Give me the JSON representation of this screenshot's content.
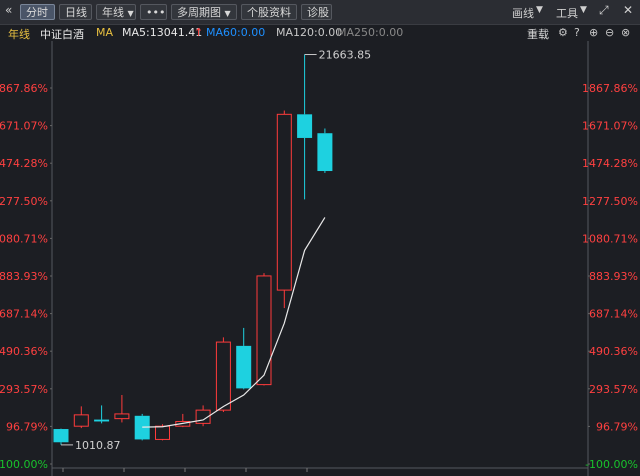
{
  "toolbar": {
    "back_icon": "chevron-double-left-icon",
    "timeshare": "分时",
    "daily": "日线",
    "period": "年线",
    "more": "•••",
    "multi_period": "多周期图",
    "stock_info": "个股资料",
    "diagnosis": "诊股",
    "draw_line": "画线",
    "tools": "工具",
    "fullscreen_icon": "expand-icon",
    "close_icon": "close-icon"
  },
  "infobar": {
    "period": "年线",
    "name": "中证白酒",
    "ma_label": "MA",
    "ma5": "MA5:13041.41",
    "ma5_arrow": "↑",
    "ma60": "MA60:0.00",
    "ma120": "MA120:0.00",
    "ma250": "MA250:0.00",
    "rights_adjust": "重载",
    "icons": [
      "gear-icon",
      "question-icon",
      "zoom-in-icon",
      "zoom-out-icon",
      "close-icon"
    ]
  },
  "colors": {
    "up": "#ff3b3b",
    "down": "#1ed1e0",
    "ma5": "#e8e8e8",
    "ma60": "#1e90ff",
    "ma120": "#c8c8c8",
    "ma250": "#888888",
    "axis_up": "#ff4040",
    "axis_down": "#19c32c"
  },
  "chart_data": {
    "type": "candlestick",
    "y_axis_labels": [
      "1867.86%",
      "1671.07%",
      "1474.28%",
      "1277.50%",
      "1080.71%",
      "883.93%",
      "687.14%",
      "490.36%",
      "293.57%",
      "96.79%",
      "-100.00%"
    ],
    "ylim_percent": [
      -100,
      1867.86
    ],
    "base_price": 1010.87,
    "max_label": "21663.85",
    "min_label": "1010.87",
    "candles": [
      {
        "open": 1850,
        "close": 1150,
        "high": 1870,
        "low": 1010.87
      },
      {
        "open": 2000,
        "close": 2600,
        "high": 3050,
        "low": 1900
      },
      {
        "open": 2350,
        "close": 2250,
        "high": 3100,
        "low": 2150
      },
      {
        "open": 2400,
        "close": 2650,
        "high": 3650,
        "low": 2200
      },
      {
        "open": 2550,
        "close": 1300,
        "high": 2650,
        "low": 1250
      },
      {
        "open": 1300,
        "close": 2000,
        "high": 2100,
        "low": 1250
      },
      {
        "open": 2000,
        "close": 2250,
        "high": 2650,
        "low": 1950
      },
      {
        "open": 2150,
        "close": 2850,
        "high": 3100,
        "low": 2000
      },
      {
        "open": 2850,
        "close": 6450,
        "high": 6700,
        "low": 2750
      },
      {
        "open": 6250,
        "close": 4000,
        "high": 7200,
        "low": 3950
      },
      {
        "open": 4200,
        "close": 9950,
        "high": 10100,
        "low": 4150
      },
      {
        "open": 9200,
        "close": 18500,
        "high": 18700,
        "low": 8250
      },
      {
        "open": 18500,
        "close": 17250,
        "high": 21663.85,
        "low": 14000
      },
      {
        "open": 17500,
        "close": 15500,
        "high": 17750,
        "low": 15400
      }
    ],
    "ma5": [
      null,
      null,
      null,
      null,
      1950,
      1970,
      2150,
      2330,
      3040,
      3650,
      4700,
      7450,
      11300,
      13041.41
    ]
  }
}
